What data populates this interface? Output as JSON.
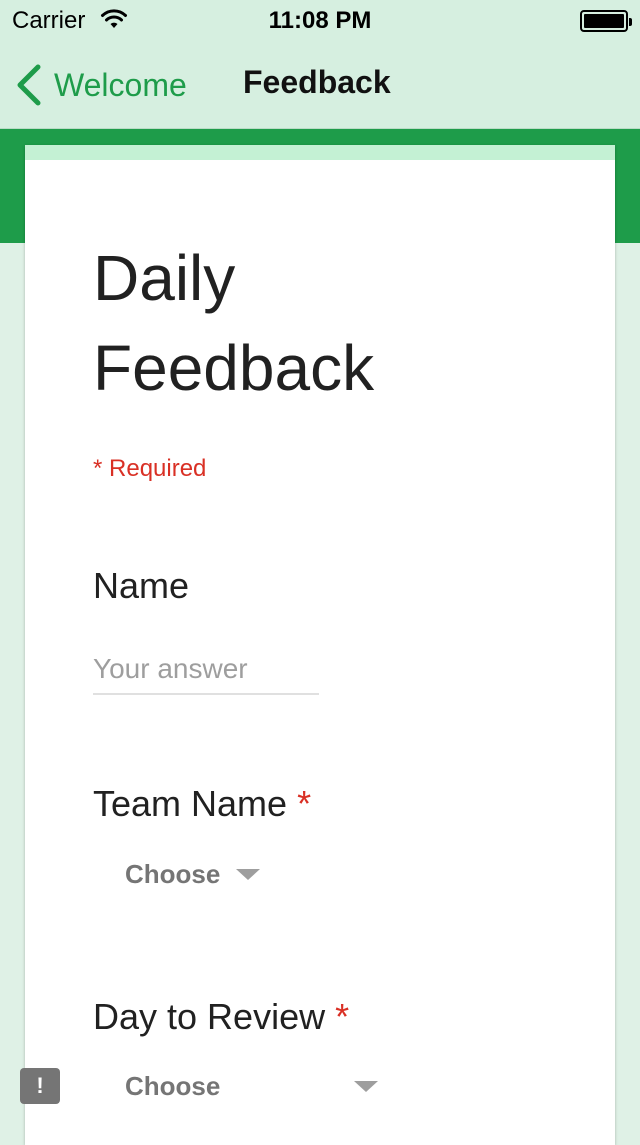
{
  "status_bar": {
    "carrier": "Carrier",
    "time": "11:08 PM"
  },
  "nav": {
    "back_label": "Welcome",
    "title": "Feedback"
  },
  "form": {
    "title": "Daily Feedback",
    "required_note": "* Required",
    "questions": [
      {
        "label": "Name",
        "required": false,
        "type": "text",
        "placeholder": "Your answer",
        "value": ""
      },
      {
        "label": "Team Name",
        "required": true,
        "type": "dropdown",
        "selected": "Choose"
      },
      {
        "label": "Day to Review",
        "required": true,
        "type": "dropdown",
        "selected": "Choose"
      }
    ]
  },
  "floating_button": {
    "icon": "exclamation-icon",
    "glyph": "!"
  },
  "colors": {
    "accent": "#1e9c4a",
    "required": "#d93025",
    "card_accent": "#c4f1d4",
    "background": "#dff1e6"
  }
}
